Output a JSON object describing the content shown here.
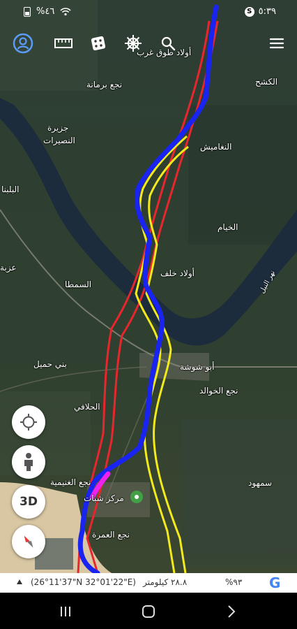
{
  "status_bar": {
    "time": "٥:٣٩",
    "battery": "%٤٦",
    "icons": [
      "alarm-icon",
      "wifi-icon",
      "battery-icon"
    ]
  },
  "toolbar": {
    "icons": [
      "profile-icon",
      "ruler-icon",
      "dice-icon",
      "ship-wheel-icon",
      "search-icon",
      "menu-icon"
    ]
  },
  "map": {
    "places": [
      {
        "id": "awlad-toq-gharb",
        "label": "أولاد طوق غرب"
      },
      {
        "id": "nagaa-barmana",
        "label": "نجع برمانة"
      },
      {
        "id": "al-kosheh",
        "label": "الكشح"
      },
      {
        "id": "jazirat-label",
        "label": "جزيرة"
      },
      {
        "id": "al-nusayrat",
        "label": "النصيرات"
      },
      {
        "id": "al-naghamish",
        "label": "النغاميش"
      },
      {
        "id": "al-balabish",
        "label": "البلبنا"
      },
      {
        "id": "al-khayam",
        "label": "الخيام"
      },
      {
        "id": "ezba",
        "label": "عزبة"
      },
      {
        "id": "awlad-khalaf",
        "label": "أولاد خلف"
      },
      {
        "id": "al-samta",
        "label": "السمطا"
      },
      {
        "id": "nile-river",
        "label": "نهر النيل"
      },
      {
        "id": "bani-humail",
        "label": "بني حميل"
      },
      {
        "id": "abu-shousha",
        "label": "أبو شوشة"
      },
      {
        "id": "nagaa-al-khawaled",
        "label": "نجع الخوالد"
      },
      {
        "id": "al-halafi",
        "label": "الحلافي"
      },
      {
        "id": "nagaa-al-ghanimiya",
        "label": "نجع الغنيمية"
      },
      {
        "id": "markaz-sohag",
        "label": "مركز شبات"
      },
      {
        "id": "nagaa-al-omra",
        "label": "نجع العمرة"
      },
      {
        "id": "sohhud",
        "label": "سمهود"
      }
    ],
    "route_colors": {
      "red": "#e8262d",
      "yellow": "#f2ea1c",
      "blue": "#1a24f0",
      "magenta": "#ee22ee"
    },
    "pin_color": "#43a047"
  },
  "fabs": {
    "location_icon": "crosshair-icon",
    "pegman_icon": "pegman-icon",
    "three_d_label": "3D",
    "compass_icon": "compass-icon"
  },
  "scale_bar": {
    "coords": "(26°11'37\"N 32°01'22\"E)",
    "distance": "٢٨.٨ كيلومتر",
    "zoom_pct": "%٩٣",
    "logo": "G"
  },
  "nav": {
    "icons": [
      "recents-icon",
      "home-icon",
      "back-icon"
    ]
  }
}
